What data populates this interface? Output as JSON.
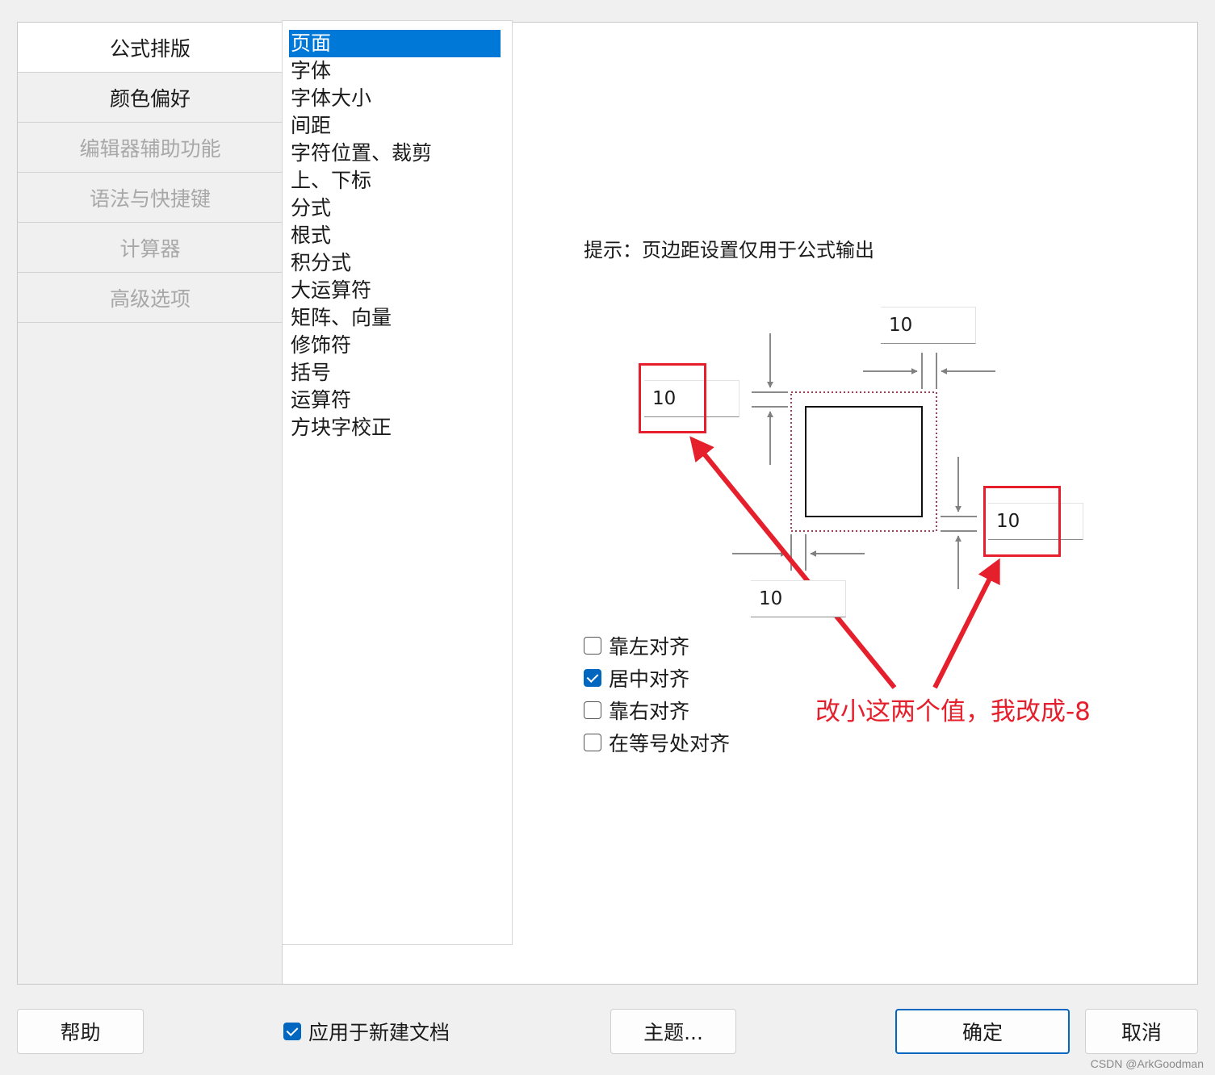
{
  "sidebar": {
    "tabs": [
      {
        "label": "公式排版",
        "state": "active"
      },
      {
        "label": "颜色偏好",
        "state": "normal"
      },
      {
        "label": "编辑器辅助功能",
        "state": "disabled"
      },
      {
        "label": "语法与快捷键",
        "state": "disabled"
      },
      {
        "label": "计算器",
        "state": "disabled"
      },
      {
        "label": "高级选项",
        "state": "disabled"
      }
    ]
  },
  "settings_list": {
    "selected": "页面",
    "items": [
      "页面",
      "字体",
      "字体大小",
      "间距",
      "字符位置、裁剪",
      "上、下标",
      "分式",
      "根式",
      "积分式",
      "大运算符",
      "矩阵、向量",
      "修饰符",
      "括号",
      "运算符",
      "方块字校正"
    ]
  },
  "page_settings": {
    "hint": "提示：页边距设置仅用于公式输出",
    "margins": {
      "top": "10",
      "left": "10",
      "right": "10",
      "bottom": "10"
    },
    "alignment_options": [
      {
        "label": "靠左对齐",
        "checked": false
      },
      {
        "label": "居中对齐",
        "checked": true
      },
      {
        "label": "靠右对齐",
        "checked": false
      },
      {
        "label": "在等号处对齐",
        "checked": false
      }
    ]
  },
  "annotation": {
    "text": "改小这两个值，我改成-8",
    "color": "#e5202c"
  },
  "footer": {
    "help_label": "帮助",
    "apply_new_docs_label": "应用于新建文档",
    "apply_new_docs_checked": true,
    "theme_label": "主题...",
    "ok_label": "确定",
    "cancel_label": "取消"
  },
  "watermark": "CSDN @ArkGoodman",
  "colors": {
    "accent": "#0078d7",
    "checkbox": "#0067c0",
    "annotation": "#e5202c"
  }
}
